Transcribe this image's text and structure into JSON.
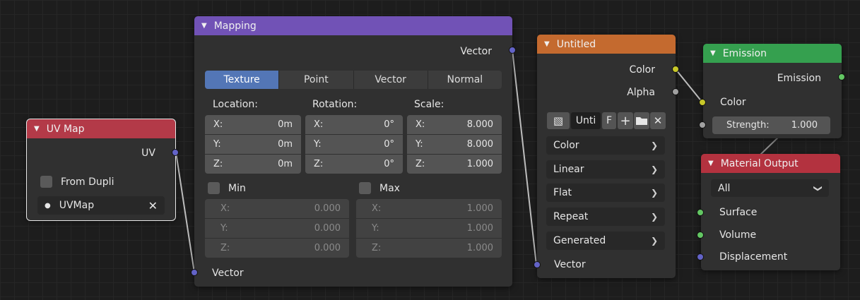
{
  "colors": {
    "background": "#1d1d1d",
    "node_body": "#303030",
    "uvmap_header": "#b33a48",
    "mapping_header": "#7152b6",
    "texture_header": "#c46a2f",
    "emission_header": "#35a04f",
    "output_header": "#b3323f",
    "socket_vector": "#6363c7",
    "socket_color": "#c7c729",
    "socket_gray": "#a1a1a1",
    "socket_shader": "#63c763",
    "active_button": "#5376b6"
  },
  "uvmap": {
    "title": "UV Map",
    "output_uv": "UV",
    "from_dupli": "From Dupli",
    "uvmap_value": "UVMap",
    "clear_icon": "close-icon"
  },
  "mapping": {
    "title": "Mapping",
    "output_vector": "Vector",
    "tabs": [
      "Texture",
      "Point",
      "Vector",
      "Normal"
    ],
    "location_label": "Location:",
    "rotation_label": "Rotation:",
    "scale_label": "Scale:",
    "location": [
      {
        "axis": "X:",
        "value": "0m"
      },
      {
        "axis": "Y:",
        "value": "0m"
      },
      {
        "axis": "Z:",
        "value": "0m"
      }
    ],
    "rotation": [
      {
        "axis": "X:",
        "value": "0°"
      },
      {
        "axis": "Y:",
        "value": "0°"
      },
      {
        "axis": "Z:",
        "value": "0°"
      }
    ],
    "scale": [
      {
        "axis": "X:",
        "value": "8.000"
      },
      {
        "axis": "Y:",
        "value": "8.000"
      },
      {
        "axis": "Z:",
        "value": "1.000"
      }
    ],
    "min_label": "Min",
    "max_label": "Max",
    "min": [
      {
        "axis": "X:",
        "value": "0.000"
      },
      {
        "axis": "Y:",
        "value": "0.000"
      },
      {
        "axis": "Z:",
        "value": "0.000"
      }
    ],
    "max": [
      {
        "axis": "X:",
        "value": "1.000"
      },
      {
        "axis": "Y:",
        "value": "1.000"
      },
      {
        "axis": "Z:",
        "value": "1.000"
      }
    ],
    "input_vector": "Vector"
  },
  "texture": {
    "title": "Untitled",
    "output_color": "Color",
    "output_alpha": "Alpha",
    "image_name": "Unti",
    "fake_user": "F",
    "new_icon": "plus-icon",
    "open_icon": "folder-icon",
    "unlink_icon": "close-icon",
    "image_icon": "image-icon",
    "color_space": "Color",
    "interpolation": "Linear",
    "projection": "Flat",
    "extension": "Repeat",
    "source": "Generated",
    "input_vector": "Vector"
  },
  "emission": {
    "title": "Emission",
    "output": "Emission",
    "input_color": "Color",
    "strength_label": "Strength:",
    "strength_value": "1.000"
  },
  "output": {
    "title": "Material Output",
    "target": "All",
    "surface": "Surface",
    "volume": "Volume",
    "displacement": "Displacement"
  }
}
